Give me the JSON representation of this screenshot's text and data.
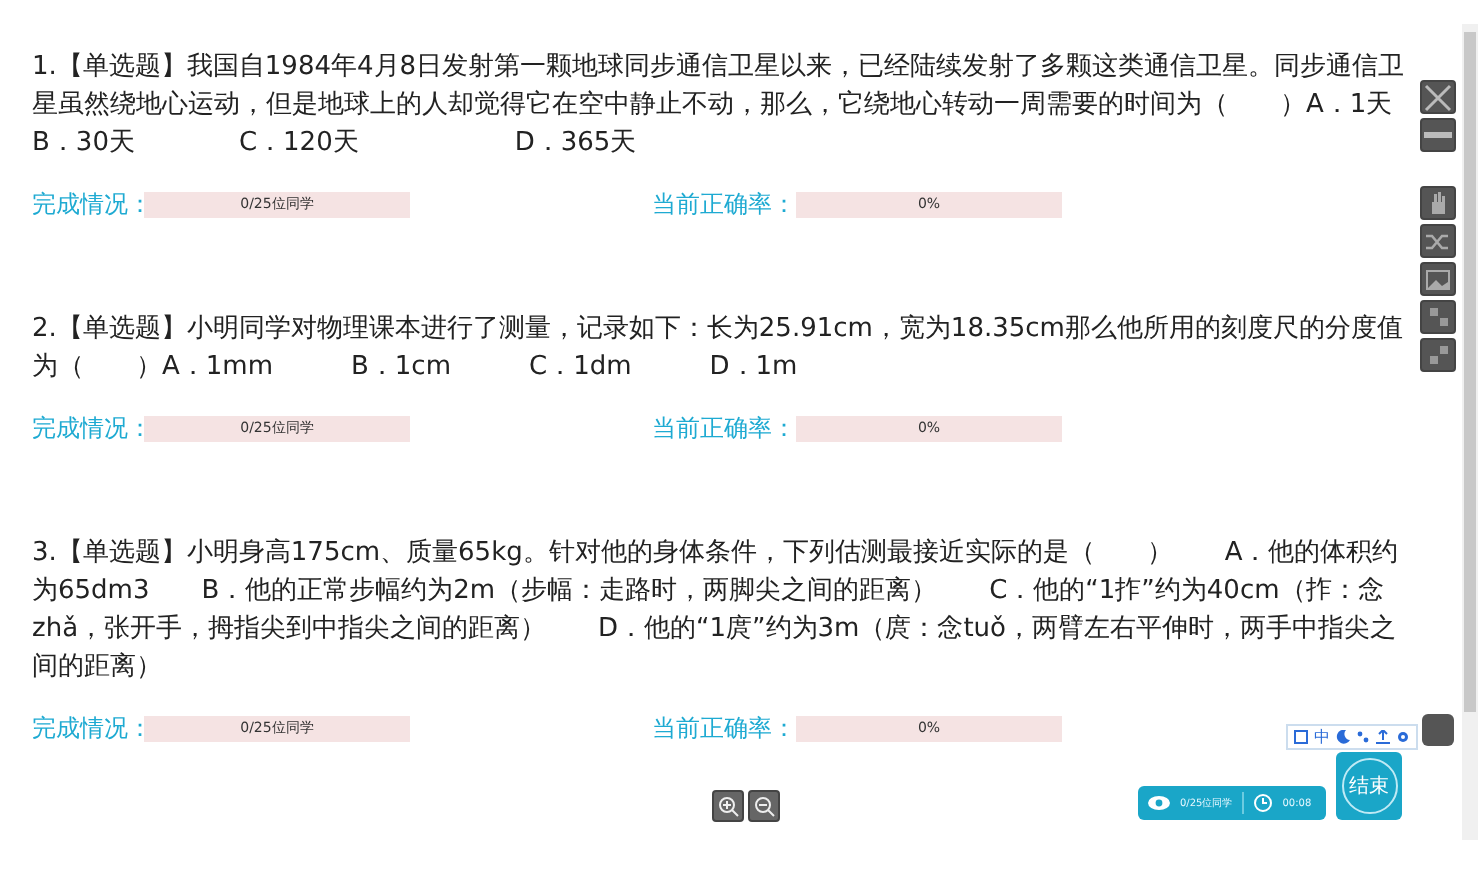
{
  "questions": [
    {
      "text": "1.【单选题】我国自1984年4月8日发射第一颗地球同步通信卫星以来，已经陆续发射了多颗这类通信卫星。同步通信卫星虽然绕地心运动，但是地球上的人却觉得它在空中静止不动，那么，它绕地心转动一周需要的时间为（　　）A．1天　　　　B．30天　　　　C．120天　　　　　　D．365天",
      "completion_label": "完成情况：",
      "completion_value": "0/25位同学",
      "accuracy_label": "当前正确率：",
      "accuracy_value": "0%"
    },
    {
      "text": "2.【单选题】小明同学对物理课本进行了测量，记录如下：长为25.91cm，宽为18.35cm那么他所用的刻度尺的分度值为（　　）A．1mm　　　B．1cm　　　C．1dm　　　D．1m",
      "completion_label": "完成情况：",
      "completion_value": "0/25位同学",
      "accuracy_label": "当前正确率：",
      "accuracy_value": "0%"
    },
    {
      "text": "3.【单选题】小明身高175cm、质量65kg。针对他的身体条件，下列估测最接近实际的是（　　）　　A．他的体积约为65dm3　　B．他的正常步幅约为2m（步幅：走路时，两脚尖之间的距离）　　C．他的“1拃”约为40cm（拃：念zhǎ，张开手，拇指尖到中指尖之间的距离）　　D．他的“1庹”约为3m（庹：念tuǒ，两臂左右平伸时，两手中指尖之间的距离）",
      "completion_label": "完成情况：",
      "completion_value": "0/25位同学",
      "accuracy_label": "当前正确率：",
      "accuracy_value": "0%"
    }
  ],
  "ime_toolbar": {
    "mode": "中"
  },
  "status": {
    "students": "0/25位同学",
    "time": "00:08"
  },
  "end_button": "结束"
}
